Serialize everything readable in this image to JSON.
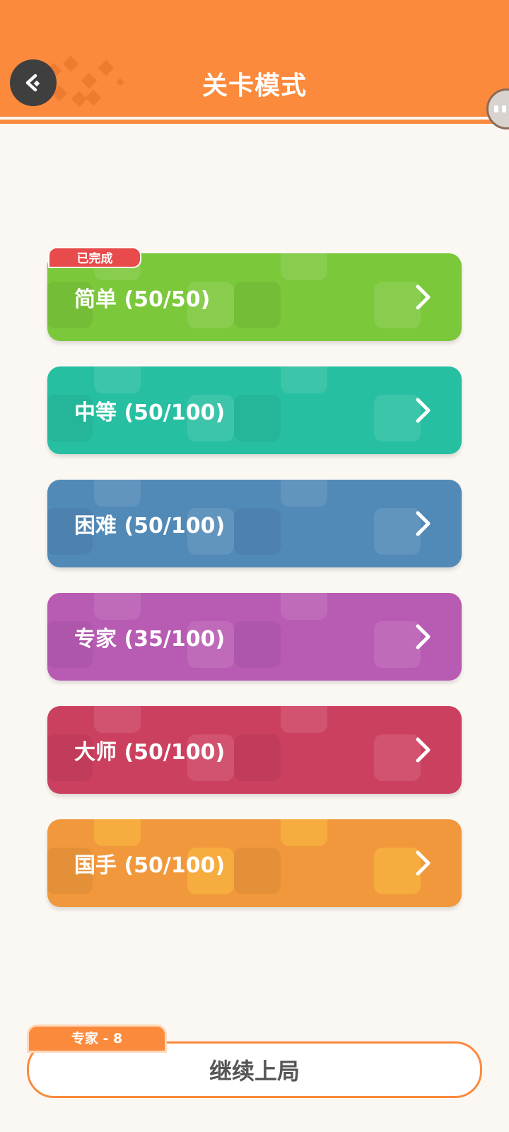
{
  "header": {
    "title": "关卡模式"
  },
  "levels": [
    {
      "label": "简单 (50/50)",
      "color": "#7bc83a",
      "badge": "已完成"
    },
    {
      "label": "中等 (50/100)",
      "color": "#27bfa1"
    },
    {
      "label": "困难 (50/100)",
      "color": "#5189b7"
    },
    {
      "label": "专家 (35/100)",
      "color": "#b85bb3"
    },
    {
      "label": "大师 (50/100)",
      "color": "#cc405f"
    },
    {
      "label": "国手 (50/100)",
      "color": "#f1983c"
    }
  ],
  "continue": {
    "tag": "专家 - 8",
    "label": "继续上局"
  },
  "icons": {
    "back": "back-arrow-icon",
    "chevron": "chevron-right-icon",
    "avatar": "avatar-icon"
  },
  "colors": {
    "header": "#fb8a3c",
    "background": "#fbf8f3",
    "badge": "#e84b4b"
  }
}
